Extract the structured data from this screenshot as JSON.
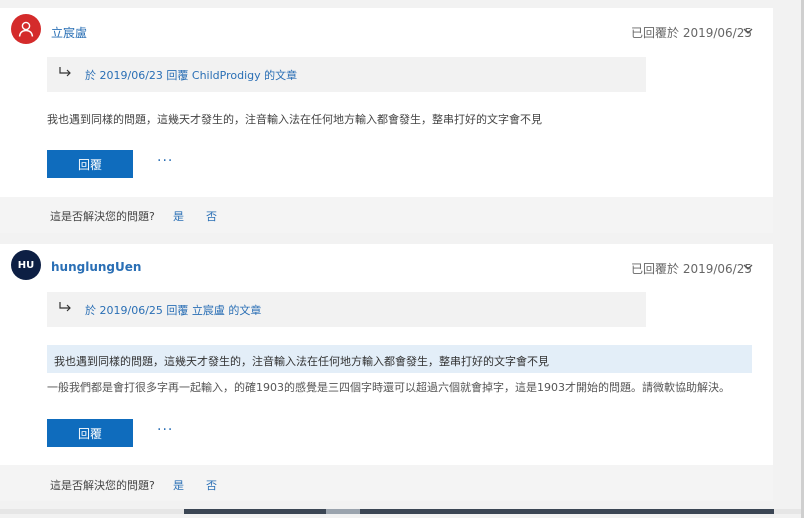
{
  "posts": [
    {
      "username": "立宸盧",
      "avatar_initials": "",
      "avatar_color": "#d42b2b",
      "replied_status": "已回覆於 2019/06/25",
      "quote": "於 2019/06/23 回覆 ChildProdigy 的文章",
      "body": "我也遇到同樣的問題，這幾天才發生的，注音輸入法在任何地方輸入都會發生，整串打好的文字會不見",
      "reply_label": "回覆",
      "more_label": "···",
      "question": "這是否解決您的問題?",
      "yes_label": "是",
      "no_label": "否"
    },
    {
      "username": "hunglungUen",
      "avatar_initials": "HU",
      "avatar_color": "#0d1f44",
      "replied_status": "已回覆於 2019/06/25",
      "quote": "於 2019/06/25 回覆 立宸盧 的文章",
      "highlight": "我也遇到同樣的問題，這幾天才發生的，注音輸入法在任何地方輸入都會發生，整串打好的文字會不見",
      "body": "一般我們都是會打很多字再一起輸入，的確1903的感覺是三四個字時還可以超過六個就會掉字，這是1903才開始的問題。請微軟協助解決。",
      "reply_label": "回覆",
      "more_label": "···",
      "question": "這是否解決您的問題?",
      "yes_label": "是",
      "no_label": "否"
    }
  ],
  "colors": {
    "accent": "#0f6cbd",
    "link": "#2a6fb5",
    "highlight_bg": "#e3eef8"
  }
}
